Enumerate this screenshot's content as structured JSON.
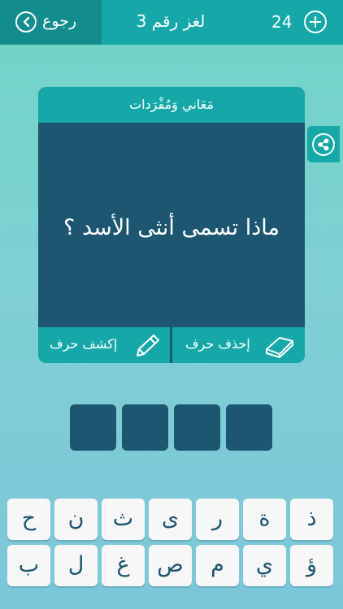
{
  "header": {
    "back_label": "رجوع",
    "level_title": "لغز رقم 3",
    "coins": "24"
  },
  "card": {
    "category": "مَعَاني وَمُفْرَدات",
    "question": "ماذا تسمى أنثى الأسد ؟",
    "reveal_label": "إكشف حرف",
    "remove_label": "إحذف حرف"
  },
  "answer_slots": [
    "",
    "",
    "",
    ""
  ],
  "keyboard": {
    "row1": [
      "ذ",
      "ة",
      "ر",
      "ى",
      "ث",
      "ن",
      "ح"
    ],
    "row2": [
      "ؤ",
      "ي",
      "م",
      "ص",
      "غ",
      "ل",
      "ب"
    ]
  },
  "colors": {
    "teal": "#16a8a8",
    "dark_teal": "#138c8e",
    "navy": "#1d5671",
    "key_bg": "#f7f7f7"
  }
}
